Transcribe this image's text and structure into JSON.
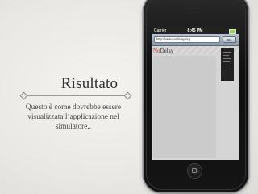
{
  "slide": {
    "title": "Risultato",
    "subtitle": "Questo è come dovrebbe essere visualizzata l’applicazione nel simulatore.."
  },
  "phone": {
    "status_bar": {
      "carrier": "Carrier",
      "time": "8:45 PM"
    },
    "browser": {
      "url_value": "http://www.nodelay.org",
      "go_label": "Go"
    },
    "webpage": {
      "logo_a": "No",
      "logo_b": "Delay"
    }
  },
  "colors": {
    "background": "#ecebe8",
    "title_text": "#333333",
    "phone_body": "#141414",
    "toolbar": "#8b98a8",
    "logo_red": "#c0392b"
  }
}
